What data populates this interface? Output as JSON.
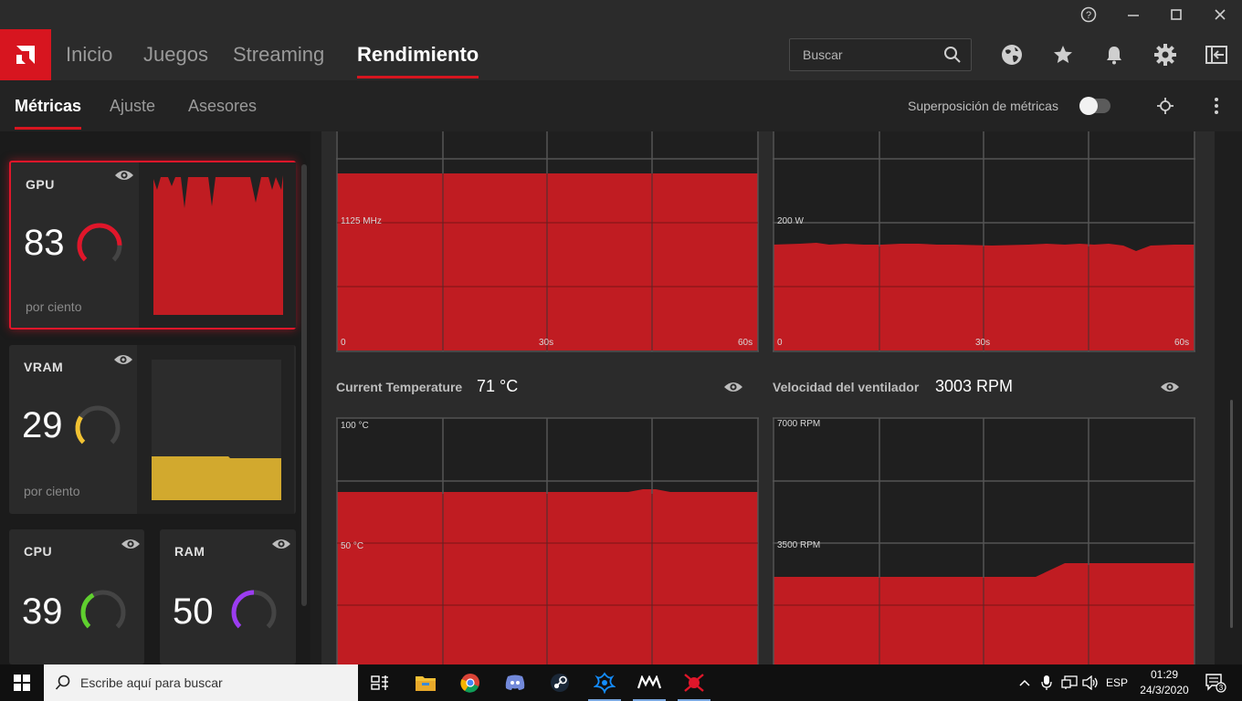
{
  "titlebar": {
    "buttons": [
      "help-icon",
      "minimize-icon",
      "maximize-icon",
      "close-icon"
    ]
  },
  "nav": {
    "tabs": [
      "Inicio",
      "Juegos",
      "Streaming",
      "Rendimiento"
    ],
    "active": "Rendimiento",
    "search_placeholder": "Buscar"
  },
  "subnav": {
    "tabs": [
      "Métricas",
      "Ajuste",
      "Asesores"
    ],
    "active": "Métricas",
    "overlay_label": "Superposición de métricas",
    "overlay_enabled": false
  },
  "metrics": {
    "gpu": {
      "label": "GPU",
      "value": "83",
      "unit": "por ciento",
      "percent": 83,
      "color": "#e0162a"
    },
    "vram": {
      "label": "VRAM",
      "value": "29",
      "unit": "por ciento",
      "percent": 29,
      "color": "#f1c232"
    },
    "cpu": {
      "label": "CPU",
      "value": "39",
      "percent": 39,
      "color": "#5fd02e"
    },
    "ram": {
      "label": "RAM",
      "value": "50",
      "percent": 50,
      "color": "#9b3cf0"
    }
  },
  "charts": {
    "clock": {
      "mid_label": "1125 MHz",
      "x_start": "0",
      "x_mid": "30s",
      "x_end": "60s",
      "fill_level": 0.13
    },
    "power": {
      "mid_label": "200 W",
      "x_start": "0",
      "x_mid": "30s",
      "x_end": "60s"
    },
    "temperature": {
      "title": "Current Temperature",
      "value": "71 °C",
      "top_label": "100 °C",
      "mid_label": "50 °C"
    },
    "fan": {
      "title": "Velocidad del ventilador",
      "value": "3003 RPM",
      "top_label": "7000 RPM",
      "mid_label": "3500 RPM"
    }
  },
  "taskbar": {
    "search_placeholder": "Escribe aquí para buscar",
    "apps": [
      "task-view-icon",
      "file-explorer-icon",
      "chrome-icon",
      "discord-icon",
      "steam-icon",
      "battlenet-icon",
      "modern-warfare-icon",
      "amd-radeon-icon"
    ],
    "language": "ESP",
    "time": "01:29",
    "date": "24/3/2020",
    "notifications": "3"
  },
  "colors": {
    "accent": "#d7151f",
    "chart_fill": "#c01c22"
  }
}
